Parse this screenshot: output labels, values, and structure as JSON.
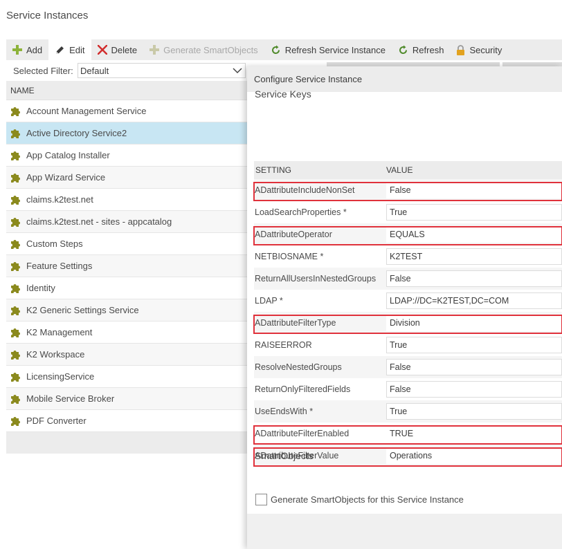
{
  "page": {
    "title": "Service Instances"
  },
  "toolbar": {
    "add": "Add",
    "edit": "Edit",
    "delete": "Delete",
    "generate": "Generate SmartObjects",
    "refresh_instance": "Refresh Service Instance",
    "refresh": "Refresh",
    "security": "Security"
  },
  "filter": {
    "label": "Selected Filter:",
    "value": "Default"
  },
  "list": {
    "header": "NAME",
    "items": [
      "Account Management Service",
      "Active Directory Service2",
      "App Catalog Installer",
      "App Wizard Service",
      "claims.k2test.net",
      "claims.k2test.net - sites - appcatalog",
      "Custom Steps",
      "Feature Settings",
      "Identity",
      "K2 Generic Settings Service",
      "K2 Management",
      "K2 Workspace",
      "LicensingService",
      "Mobile Service Broker",
      "PDF Converter"
    ]
  },
  "panel": {
    "title": "Configure Service Instance",
    "service_keys": "Service Keys",
    "col_setting": "SETTING",
    "col_value": "VALUE",
    "settings": [
      {
        "name": "ADattributeIncludeNonSet",
        "value": "False"
      },
      {
        "name": "LoadSearchProperties *",
        "value": "True"
      },
      {
        "name": "ADattributeOperator",
        "value": "EQUALS"
      },
      {
        "name": "NETBIOSNAME *",
        "value": "K2TEST"
      },
      {
        "name": "ReturnAllUsersInNestedGroups",
        "value": "False"
      },
      {
        "name": "LDAP *",
        "value": "LDAP://DC=K2TEST,DC=COM"
      },
      {
        "name": "ADattributeFilterType",
        "value": "Division"
      },
      {
        "name": "RAISEERROR",
        "value": "True"
      },
      {
        "name": "ResolveNestedGroups",
        "value": "False"
      },
      {
        "name": "ReturnOnlyFilteredFields",
        "value": "False"
      },
      {
        "name": "UseEndsWith *",
        "value": "True"
      },
      {
        "name": "ADattributeFilterEnabled",
        "value": "TRUE"
      },
      {
        "name": "ADattributeFilterValue",
        "value": "Operations"
      }
    ],
    "smartobjects": "SmartObjects",
    "generate_label": "Generate SmartObjects for this Service Instance"
  },
  "colors": {
    "highlight": "#e0313b",
    "selected_row": "#c8e6f3",
    "puzzle_icon": "#8b8a1e",
    "add_icon": "#8db33a",
    "delete_icon": "#d12e2e",
    "refresh_icon": "#4f8a2a",
    "lock_icon": "#e2a21f"
  }
}
